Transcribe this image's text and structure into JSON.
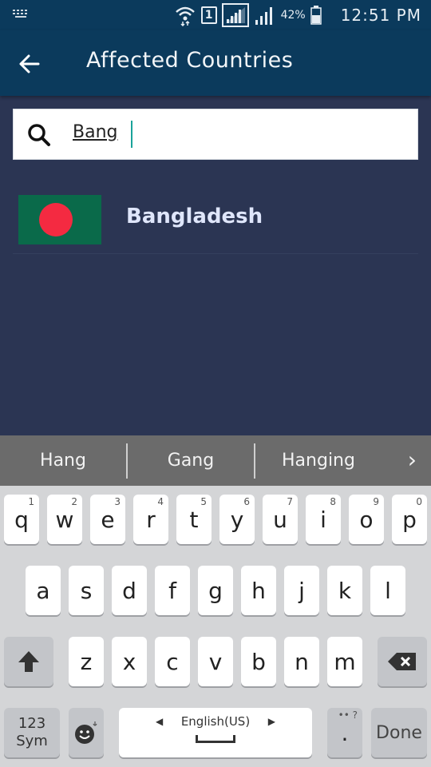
{
  "status_bar": {
    "battery_percent": "42%",
    "time": "12:51 PM",
    "sim": "1"
  },
  "app_bar": {
    "title": "Affected Countries",
    "back_icon": "arrow-left-icon"
  },
  "search": {
    "icon": "search-icon",
    "value": "Bang"
  },
  "results": [
    {
      "name": "Bangladesh",
      "flag": "bangladesh-flag"
    }
  ],
  "suggestions": [
    "Hang",
    "Gang",
    "Hanging"
  ],
  "keyboard": {
    "row1": [
      {
        "key": "q",
        "hint": "1"
      },
      {
        "key": "w",
        "hint": "2"
      },
      {
        "key": "e",
        "hint": "3"
      },
      {
        "key": "r",
        "hint": "4"
      },
      {
        "key": "t",
        "hint": "5"
      },
      {
        "key": "y",
        "hint": "6"
      },
      {
        "key": "u",
        "hint": "7"
      },
      {
        "key": "i",
        "hint": "8"
      },
      {
        "key": "o",
        "hint": "9"
      },
      {
        "key": "p",
        "hint": "0"
      }
    ],
    "row2": [
      "a",
      "s",
      "d",
      "f",
      "g",
      "h",
      "j",
      "k",
      "l"
    ],
    "row3": [
      "z",
      "x",
      "c",
      "v",
      "b",
      "n",
      "m"
    ],
    "sym_line1": "123",
    "sym_line2": "Sym",
    "language": "English(US)",
    "period": ".",
    "period_hint": "•• ?",
    "done": "Done"
  },
  "colors": {
    "app_bar": "#0b3a5c",
    "background": "#2b3553",
    "flag_green": "#0a6a4a",
    "flag_red": "#f42a41"
  }
}
